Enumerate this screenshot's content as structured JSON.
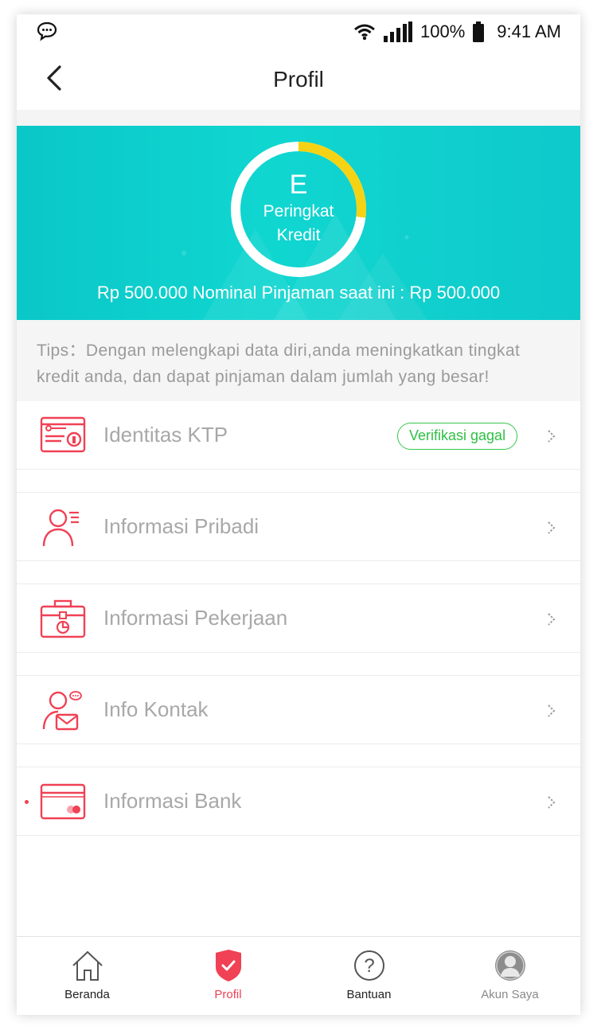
{
  "status_bar": {
    "battery": "100%",
    "time": "9:41 AM",
    "icons": [
      "chat-bubble-icon",
      "wifi-icon",
      "signal-icon",
      "battery-icon"
    ]
  },
  "header": {
    "title": "Profil",
    "back_icon": "chevron-left-icon"
  },
  "banner": {
    "grade": "E",
    "label_line1": "Peringkat",
    "label_line2": "Kredit",
    "amount_text": "Rp 500.000 Nominal Pinjaman saat ini : Rp 500.000",
    "gauge_fill": 0.27,
    "colors": {
      "background": "#10d6d0",
      "gauge_fill": "#f5d314",
      "gauge_track": "#ffffff"
    }
  },
  "tips": {
    "text": "Tips：Dengan melengkapi data diri,anda meningkatkan tingkat kredit anda, dan dapat pinjaman dalam jumlah yang besar!"
  },
  "menu": {
    "items": [
      {
        "label": "Identitas KTP",
        "icon": "id-card-icon",
        "badge": "Verifikasi gagal"
      },
      {
        "label": "Informasi Pribadi",
        "icon": "person-icon"
      },
      {
        "label": "Informasi Pekerjaan",
        "icon": "briefcase-icon"
      },
      {
        "label": "Info Kontak",
        "icon": "contact-mail-icon"
      },
      {
        "label": "Informasi Bank",
        "icon": "bank-card-icon"
      }
    ],
    "colors": {
      "icon": "#f04155",
      "badge": "#35c84a"
    }
  },
  "tab_bar": {
    "tabs": [
      {
        "label": "Beranda",
        "icon": "home-icon"
      },
      {
        "label": "Profil",
        "icon": "shield-check-icon",
        "active": true
      },
      {
        "label": "Bantuan",
        "icon": "help-circle-icon"
      },
      {
        "label": "Akun Saya",
        "icon": "avatar-icon"
      }
    ],
    "colors": {
      "active": "#f04155"
    }
  }
}
